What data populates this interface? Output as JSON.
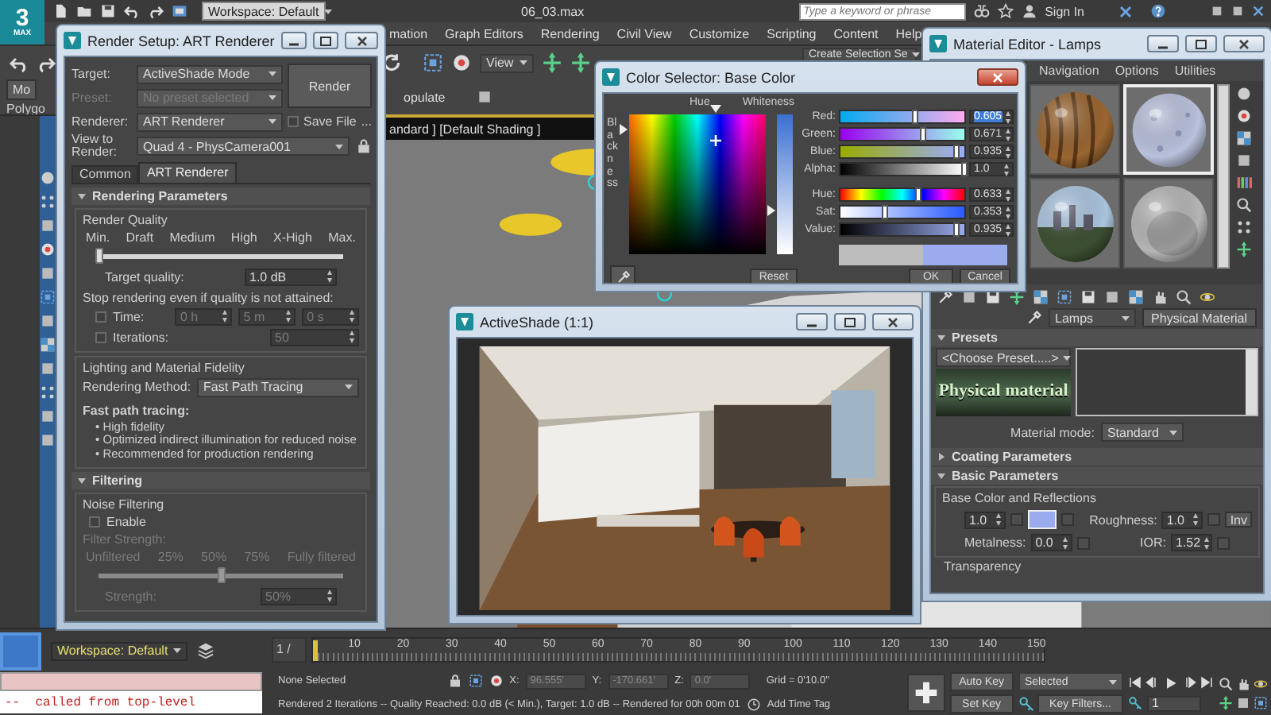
{
  "app": {
    "logo": "3",
    "logo_caption": "MAX",
    "workspace": "Workspace: Default",
    "file_name": "06_03.max",
    "search": {
      "placeholder": "Type a keyword or phrase"
    },
    "sign_in": "Sign In"
  },
  "menu": [
    "mation",
    "Graph Editors",
    "Rendering",
    "Civil View",
    "Customize",
    "Scripting",
    "Content",
    "Help"
  ],
  "toolbar": {
    "view": "View",
    "selection_set": "Create Selection Se"
  },
  "ribbon": {
    "tab": "Mo",
    "panel": "Polygo",
    "populate": "opulate"
  },
  "viewport": {
    "label": "andard ] [Default Shading ]"
  },
  "render_setup": {
    "title": "Render Setup: ART Renderer",
    "target": {
      "label": "Target:",
      "value": "ActiveShade Mode"
    },
    "preset": {
      "label": "Preset:",
      "placeholder": "No preset selected"
    },
    "renderer": {
      "label": "Renderer:",
      "value": "ART Renderer"
    },
    "save_file": {
      "label": "Save File",
      "checked": false
    },
    "more": "...",
    "view": {
      "label": "View to Render:",
      "value": "Quad 4 - PhysCamera001"
    },
    "render_button": "Render",
    "tabs": [
      {
        "label": "Common",
        "selected": false
      },
      {
        "label": "ART Renderer",
        "selected": true
      }
    ],
    "rendering": {
      "title": "Rendering Parameters",
      "expanded": true,
      "quality_group": "Render Quality",
      "quality_ticks": [
        "Min.",
        "Draft",
        "Medium",
        "High",
        "X-High",
        "Max."
      ],
      "quality": {
        "level": 0
      },
      "target_quality": {
        "label": "Target quality:",
        "value": "1.0 dB"
      },
      "stop_note": "Stop rendering even if quality is not attained:",
      "time": {
        "label": "Time:",
        "checked": false,
        "values": [
          "0 h",
          "5 m",
          "0 s"
        ]
      },
      "iterations": {
        "label": "Iterations:",
        "checked": false,
        "value": "50"
      }
    },
    "fidelity": {
      "title": "Lighting and Material Fidelity",
      "method": {
        "label": "Rendering Method:",
        "value": "Fast Path Tracing"
      },
      "heading": "Fast path tracing:",
      "bullets": [
        "• High fidelity",
        "• Optimized indirect illumination for reduced noise",
        "• Recommended for production rendering"
      ]
    },
    "filtering": {
      "title": "Filtering",
      "expanded": true,
      "disabled": true,
      "group": "Noise Filtering",
      "enable": {
        "label": "Enable",
        "checked": false
      },
      "strength_title": "Filter Strength:",
      "ticks": [
        "Unfiltered",
        "25%",
        "50%",
        "75%",
        "Fully filtered"
      ],
      "strength": {
        "level": 0.5,
        "label": "Strength:",
        "value": "50%"
      }
    }
  },
  "color_selector": {
    "title": "Color Selector: Base Color",
    "hue_label": "Hue",
    "whiteness_label": "Whiteness",
    "blackness_label": "Blackness",
    "channels": [
      {
        "kind": "red",
        "label": "Red:",
        "value": "0.605",
        "level": 0.605,
        "selected": true
      },
      {
        "kind": "green",
        "label": "Green:",
        "value": "0.671",
        "level": 0.671,
        "selected": false
      },
      {
        "kind": "blue",
        "label": "Blue:",
        "value": "0.935",
        "level": 0.935,
        "selected": false
      },
      {
        "kind": "alpha",
        "label": "Alpha:",
        "value": "1.0",
        "level": 1.0,
        "selected": false
      },
      {
        "kind": "hue",
        "label": "Hue:",
        "value": "0.633",
        "level": 0.633,
        "selected": false
      },
      {
        "kind": "sat",
        "label": "Sat:",
        "value": "0.353",
        "level": 0.353,
        "selected": false
      },
      {
        "kind": "value",
        "label": "Value:",
        "value": "0.935",
        "level": 0.935,
        "selected": false
      }
    ],
    "reset": "Reset",
    "ok": "OK",
    "cancel": "Cancel"
  },
  "material_editor": {
    "title": "Material Editor - Lamps",
    "menu": [
      "Navigation",
      "Options",
      "Utilities"
    ],
    "samples": [
      {
        "kind": "wood",
        "selected": false
      },
      {
        "kind": "stone",
        "selected": true
      },
      {
        "kind": "sky",
        "selected": false
      },
      {
        "kind": "matte",
        "selected": false
      }
    ],
    "material_name": "Lamps",
    "material_type": "Physical Material",
    "presets": {
      "title": "Presets",
      "expanded": true,
      "choose": "<Choose Preset.....>",
      "banner": "Physical material"
    },
    "material_mode": {
      "label": "Material mode:",
      "value": "Standard"
    },
    "coating": {
      "title": "Coating Parameters",
      "expanded": false
    },
    "basic": {
      "title": "Basic Parameters",
      "expanded": true,
      "group": "Base Color and Reflections",
      "weight": "1.0",
      "roughness": {
        "label": "Roughness:",
        "value": "1.0"
      },
      "inv": "Inv",
      "metalness": {
        "label": "Metalness:",
        "value": "0.0"
      },
      "ior": {
        "label": "IOR:",
        "value": "1.52"
      },
      "next_group": "Transparency"
    }
  },
  "active_shade": {
    "title": "ActiveShade (1:1)"
  },
  "bottom": {
    "workspace": "Workspace: Default",
    "listener_output": "--  called from top-level"
  },
  "timeline": {
    "frame": "1 /",
    "level": 0,
    "ticks": [
      "10",
      "20",
      "30",
      "40",
      "50",
      "60",
      "70",
      "80",
      "90",
      "100",
      "110",
      "120",
      "130",
      "140",
      "150"
    ]
  },
  "status": {
    "selection": "None Selected",
    "x": {
      "label": "X:",
      "value": "96.555'"
    },
    "y": {
      "label": "Y:",
      "value": "-170.661'"
    },
    "z": {
      "label": "Z:",
      "value": "0.0'"
    },
    "grid": "Grid = 0'10.0\"",
    "message": "Rendered 2 Iterations -- Quality Reached: 0.0 dB (< Min.), Target: 1.0 dB -- Rendered for 00h 00m 01",
    "time_tag": "Add Time Tag"
  },
  "animation": {
    "auto_key": "Auto Key",
    "set_key": "Set Key",
    "key_mode": "Selected",
    "key_filters": "Key Filters...",
    "frame": "1"
  }
}
